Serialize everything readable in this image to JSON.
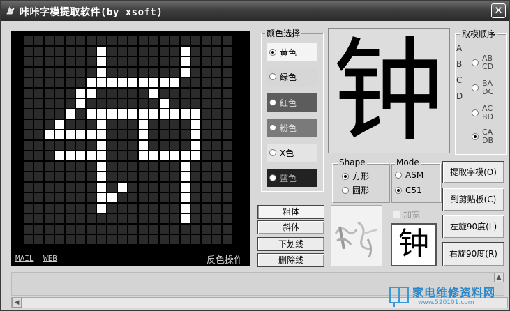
{
  "window": {
    "title": "咔咔字模提取软件(by xsoft)",
    "close_glyph": "✕"
  },
  "grid": {
    "rows": 20,
    "cols": 20,
    "pattern": [
      "....................",
      ".......#.......#....",
      ".......#.......#....",
      ".......#.......#....",
      "......#########.....",
      ".....##.....#.......",
      ".....#.......#......",
      "....#.###########...",
      "...#...#...#....#...",
      "..######...#....#...",
      ".......#...#....#...",
      "...#####...######...",
      ".......#.......#....",
      ".......#.......#....",
      ".......#.#.....#....",
      ".......##......#....",
      ".......#.......#....",
      "...............#....",
      "....................",
      "...................."
    ]
  },
  "panel_links": {
    "mail": "MAIL",
    "web": "WEB",
    "invert": "反色操作"
  },
  "color_group": {
    "title": "颜色选择",
    "options": [
      {
        "label": "黄色",
        "selected": true,
        "bg": "#f4f4f4",
        "fg": "#000000"
      },
      {
        "label": "绿色",
        "selected": false,
        "bg": "#d6d6d6",
        "fg": "#000000"
      },
      {
        "label": "红色",
        "selected": false,
        "bg": "#5c5c5c",
        "fg": "#dddddd"
      },
      {
        "label": "粉色",
        "selected": false,
        "bg": "#7a7a7a",
        "fg": "#dddddd"
      },
      {
        "label": "X色",
        "selected": false,
        "bg": "#e4e4e4",
        "fg": "#000000"
      },
      {
        "label": "蓝色",
        "selected": false,
        "bg": "#222222",
        "fg": "#aaaaaa"
      }
    ]
  },
  "preview_char": "钟",
  "order_group": {
    "title": "取模顺序",
    "letters": "A B C D",
    "options": [
      {
        "label": "AB\nCD",
        "l1": "AB",
        "l2": "CD",
        "selected": false
      },
      {
        "label": "BA\nDC",
        "l1": "BA",
        "l2": "DC",
        "selected": false
      },
      {
        "label": "AC\nBD",
        "l1": "AC",
        "l2": "BD",
        "selected": false
      },
      {
        "label": "CA\nDB",
        "l1": "CA",
        "l2": "DB",
        "selected": true
      }
    ]
  },
  "shape_group": {
    "title": "Shape",
    "options": [
      {
        "label": "方形",
        "selected": true
      },
      {
        "label": "圆形",
        "selected": false
      }
    ]
  },
  "mode_group": {
    "title": "Mode",
    "options": [
      {
        "label": "ASM",
        "selected": false
      },
      {
        "label": "C51",
        "selected": true
      }
    ]
  },
  "style_buttons": {
    "bold": "粗体",
    "italic": "斜体",
    "underline": "下划线",
    "strike": "删除线"
  },
  "widen": {
    "label": "加宽",
    "checked": false
  },
  "small_char": "钟",
  "action_buttons": {
    "extract": "提取字模(O)",
    "clipboard": "到剪贴板(C)",
    "rotate_left": "左旋90度(L)",
    "rotate_right": "右旋90度(R)"
  },
  "watermark": {
    "title": "家电维修资料网",
    "url": "www.520101.com"
  },
  "scroll": {
    "up": "▲",
    "left": "◀"
  }
}
